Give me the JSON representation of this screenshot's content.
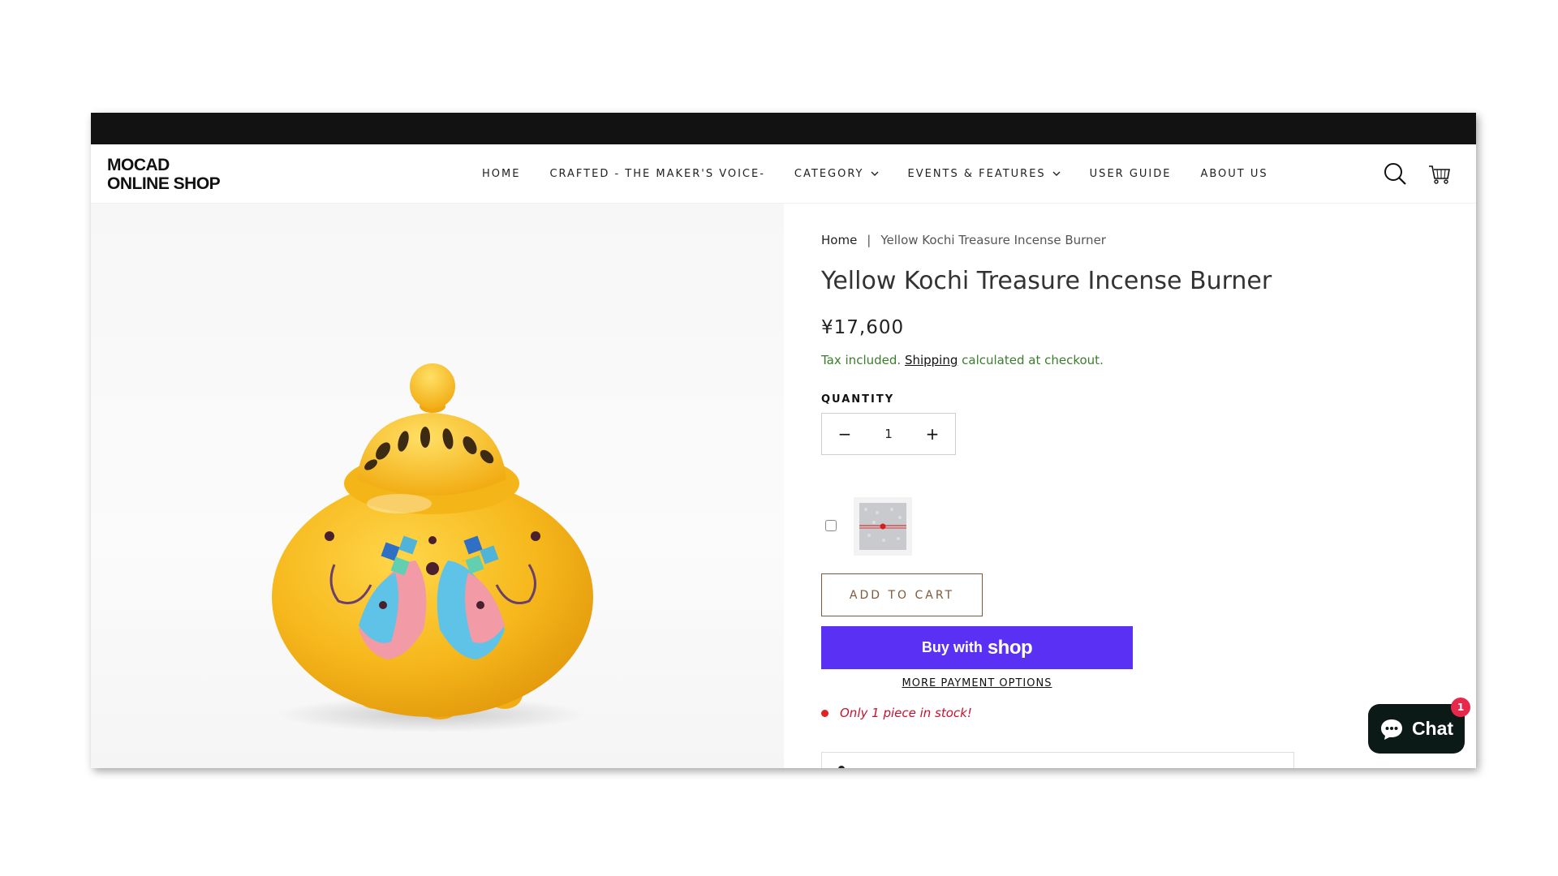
{
  "header": {
    "logo_line1": "MOCAD",
    "logo_line2": "ONLINE SHOP",
    "nav": [
      {
        "label": "HOME"
      },
      {
        "label": "CRAFTED - THE MAKER'S VOICE-"
      },
      {
        "label": "CATEGORY",
        "dropdown": true
      },
      {
        "label": "EVENTS & FEATURES",
        "dropdown": true
      },
      {
        "label": "USER GUIDE"
      },
      {
        "label": "ABOUT US"
      }
    ],
    "icons": [
      "search-icon",
      "cart-icon"
    ]
  },
  "product": {
    "breadcrumb_home": "Home",
    "breadcrumb_sep": "|",
    "breadcrumb_current": "Yellow Kochi Treasure Incense Burner",
    "title": "Yellow Kochi Treasure Incense Burner",
    "price": "¥17,600",
    "tax_prefix": "Tax included.",
    "tax_link": "Shipping",
    "tax_suffix": "calculated at checkout.",
    "quantity_label": "QUANTITY",
    "quantity_value": "1",
    "qty_minus": "−",
    "qty_plus": "+",
    "addon_checked": false,
    "add_to_cart": "ADD TO CART",
    "shop_pay_prefix": "Buy with",
    "shop_pay_brand": "shop",
    "more_payment": "MORE PAYMENT OPTIONS",
    "stock_message": "Only 1 piece in stock!"
  },
  "chat": {
    "label": "Chat",
    "badge": "1"
  },
  "colors": {
    "shop_pay": "#5a31f4",
    "add_to_cart_border": "#7a5a3c",
    "tax_text": "#3a7d2c",
    "stock_text": "#c8102e",
    "chat_bg": "#0c1a17",
    "badge": "#e8284b",
    "product_yellow": "#f6b81c"
  }
}
